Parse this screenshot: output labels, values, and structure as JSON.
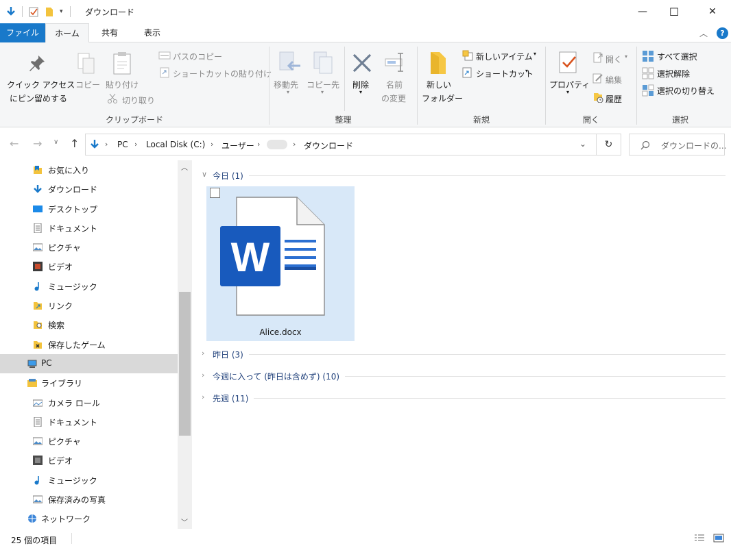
{
  "window": {
    "title": "ダウンロード",
    "min_glyph": "—",
    "max_glyph": "☐",
    "close_glyph": "✕"
  },
  "tabs": [
    {
      "label": "ファイル"
    },
    {
      "label": "ホーム"
    },
    {
      "label": "共有"
    },
    {
      "label": "表示"
    }
  ],
  "ribbon": {
    "clipboard": {
      "pin_label_1": "クイック アクセス",
      "pin_label_2": "にピン留めする",
      "copy": "コピー",
      "paste": "貼り付け",
      "copy_path": "パスのコピー",
      "paste_shortcut": "ショートカットの貼り付け",
      "cut": "切り取り",
      "group": "クリップボード"
    },
    "organize": {
      "move_to": "移動先",
      "copy_to": "コピー先",
      "delete": "削除",
      "rename_1": "名前",
      "rename_2": "の変更",
      "group": "整理"
    },
    "new": {
      "new_folder_1": "新しい",
      "new_folder_2": "フォルダー",
      "new_item": "新しいアイテム",
      "shortcut": "ショートカット",
      "group": "新規"
    },
    "open": {
      "properties": "プロパティ",
      "open": "開く",
      "edit": "編集",
      "history": "履歴",
      "group": "開く"
    },
    "select": {
      "select_all": "すべて選択",
      "select_none": "選択解除",
      "invert": "選択の切り替え",
      "group": "選択"
    }
  },
  "address": {
    "crumbs": [
      "PC",
      "Local Disk (C:)",
      "ユーザー",
      "ダウンロード"
    ],
    "search_placeholder": "ダウンロードの..."
  },
  "nav": {
    "items": [
      {
        "label": "お気に入り",
        "icon": "favorites-folder-icon"
      },
      {
        "label": "ダウンロード",
        "icon": "download-arrow-icon"
      },
      {
        "label": "デスクトップ",
        "icon": "desktop-icon"
      },
      {
        "label": "ドキュメント",
        "icon": "documents-icon"
      },
      {
        "label": "ピクチャ",
        "icon": "pictures-icon"
      },
      {
        "label": "ビデオ",
        "icon": "videos-icon"
      },
      {
        "label": "ミュージック",
        "icon": "music-icon"
      },
      {
        "label": "リンク",
        "icon": "links-folder-icon"
      },
      {
        "label": "検索",
        "icon": "search-folder-icon"
      },
      {
        "label": "保存したゲーム",
        "icon": "saved-games-icon"
      },
      {
        "label": "PC",
        "icon": "pc-icon"
      },
      {
        "label": "ライブラリ",
        "icon": "library-icon"
      },
      {
        "label": "カメラ ロール",
        "icon": "camera-roll-icon"
      },
      {
        "label": "ドキュメント",
        "icon": "documents-library-icon"
      },
      {
        "label": "ピクチャ",
        "icon": "pictures-library-icon"
      },
      {
        "label": "ビデオ",
        "icon": "videos-library-icon"
      },
      {
        "label": "ミュージック",
        "icon": "music-library-icon"
      },
      {
        "label": "保存済みの写真",
        "icon": "saved-pictures-icon"
      },
      {
        "label": "ネットワーク",
        "icon": "network-icon"
      }
    ]
  },
  "content": {
    "groups": [
      {
        "label": "今日 (1)",
        "expanded": true
      },
      {
        "label": "昨日 (3)",
        "expanded": false
      },
      {
        "label": "今週に入って (昨日は含めず) (10)",
        "expanded": false
      },
      {
        "label": "先週 (11)",
        "expanded": false
      }
    ],
    "file": {
      "name": "Alice.docx",
      "icon_letter": "W"
    }
  },
  "status": {
    "count": "25 個の項目"
  },
  "colors": {
    "accent": "#1979ca",
    "word_blue": "#185abd",
    "selection": "#d8e8f8"
  }
}
